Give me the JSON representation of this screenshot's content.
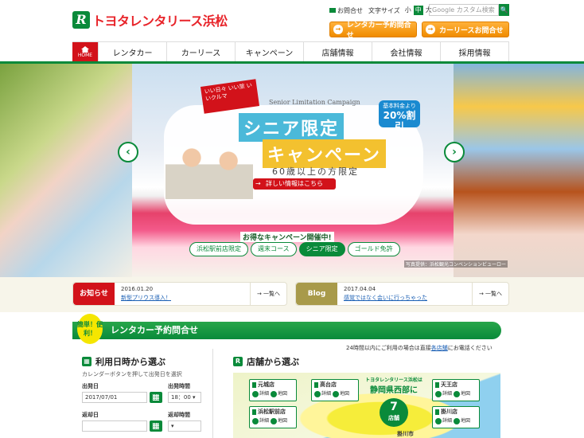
{
  "header": {
    "logo_mark": "R",
    "brand": "トヨタレンタリース",
    "city": "浜松",
    "contact_label": "お問合せ",
    "font_size_label": "文字サイズ",
    "font_sizes": [
      "小",
      "中",
      "大"
    ],
    "search_placeholder": "Google カスタム検索",
    "search_btn": "🔍",
    "btn_rental": "レンタカー予約問合せ",
    "btn_lease": "カーリースお問合せ"
  },
  "nav": {
    "home": "HOME",
    "items": [
      "レンタカー",
      "カーリース",
      "キャンペーン",
      "店舗情報",
      "会社情報",
      "採用情報"
    ]
  },
  "hero": {
    "flag": "いい日々 いい旅 いいクルマ",
    "campaign_en": "Senior Limitation Campaign",
    "title1": "シニア限定",
    "title2": "キャンペーン",
    "subtitle": "60歳以上の方限定",
    "badge_line1": "基本料金より",
    "badge_line2": "20%割引",
    "detail": "詳しい情報はこちら",
    "deal": "お得なキャンペーン開催中!",
    "pills": [
      "浜松駅前店限定",
      "週末コース",
      "シニア限定",
      "ゴールド免許"
    ],
    "credit": "写真提供：浜松観光コンベンションビューロー",
    "prev": "‹",
    "next": "›"
  },
  "news": {
    "tag": "お知らせ",
    "date": "2016.01.20",
    "text": "新型プリウス導入！",
    "more": "一覧へ"
  },
  "blog": {
    "tag": "Blog",
    "date": "2017.04.04",
    "text": "感覚ではなく会いに行っちゃった",
    "more": "一覧へ"
  },
  "reserve": {
    "easy": "簡単！便利！",
    "title": "レンタカー予約問合せ",
    "notice_a": "24時間以内にご利用の場合は直接",
    "notice_link": "各店舗",
    "notice_b": "にお電話ください",
    "date_title": "利用日時から選ぶ",
    "hint": "カレンダーボタンを押して出発日を選択",
    "depart_date_label": "出発日",
    "depart_date": "2017/07/01",
    "depart_time_label": "出発時間",
    "depart_time": "18：00",
    "return_date_label": "返却日",
    "return_time_label": "返却時間",
    "store_title": "店舗から選ぶ",
    "shops": [
      "元城店",
      "高台店",
      "天王店",
      "浜松駅前店",
      "掛川店"
    ],
    "detail_label": "詳細",
    "map_label": "地図",
    "west_top": "トヨタレンタリース浜松は",
    "west_big": "静岡県西部に",
    "west_count": "7",
    "west_suffix": "店舗",
    "pin_label": "掛川市"
  },
  "colors": {
    "brand_green": "#0a8a3a",
    "brand_red": "#d2121a",
    "orange": "#f08c00"
  }
}
